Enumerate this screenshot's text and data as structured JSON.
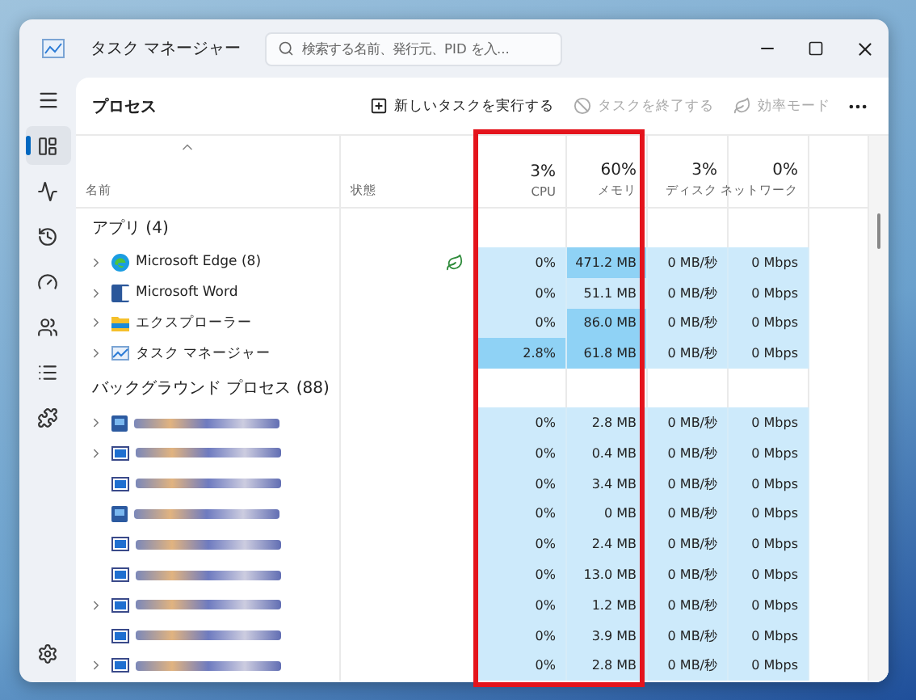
{
  "window": {
    "title": "タスク マネージャー"
  },
  "search": {
    "placeholder": "検索する名前、発行元、PID を入..."
  },
  "page_title": "プロセス",
  "toolbar": [
    {
      "kind": "run",
      "label": "新しいタスクを実行する",
      "disabled": false
    },
    {
      "kind": "end",
      "label": "タスクを終了する",
      "disabled": true
    },
    {
      "kind": "eco",
      "label": "効率モード",
      "disabled": true
    }
  ],
  "nav": [
    {
      "kind": "processes",
      "selected": true
    },
    {
      "kind": "performance",
      "selected": false
    },
    {
      "kind": "history",
      "selected": false
    },
    {
      "kind": "startup",
      "selected": false
    },
    {
      "kind": "users",
      "selected": false
    },
    {
      "kind": "details",
      "selected": false
    },
    {
      "kind": "services",
      "selected": false
    }
  ],
  "columns": [
    {
      "kind": "name",
      "label": "名前"
    },
    {
      "kind": "status",
      "label": "状態"
    },
    {
      "kind": "cpu",
      "total": "3%",
      "label": "CPU"
    },
    {
      "kind": "memory",
      "total": "60%",
      "label": "メモリ"
    },
    {
      "kind": "disk",
      "total": "3%",
      "label": "ディスク"
    },
    {
      "kind": "network",
      "total": "0%",
      "label": "ネットワーク"
    }
  ],
  "groups": [
    {
      "title": "アプリ (4)",
      "rows": [
        {
          "kind": "edge",
          "name": "Microsoft Edge (8)",
          "expandable": true,
          "efficiency": true,
          "cpu": "0%",
          "cpu_high": false,
          "memory": "471.2 MB",
          "memory_high": true,
          "disk": "0 MB/秒",
          "network": "0 Mbps"
        },
        {
          "kind": "word",
          "name": "Microsoft Word",
          "expandable": true,
          "cpu": "0%",
          "cpu_high": false,
          "memory": "51.1 MB",
          "memory_high": false,
          "disk": "0 MB/秒",
          "network": "0 Mbps"
        },
        {
          "kind": "folder",
          "name": "エクスプローラー",
          "expandable": true,
          "cpu": "0%",
          "cpu_high": false,
          "memory": "86.0 MB",
          "memory_high": true,
          "disk": "0 MB/秒",
          "network": "0 Mbps"
        },
        {
          "kind": "taskmgr",
          "name": "タスク マネージャー",
          "expandable": true,
          "cpu": "2.8%",
          "cpu_high": true,
          "memory": "61.8 MB",
          "memory_high": true,
          "disk": "0 MB/秒",
          "network": "0 Mbps"
        }
      ]
    },
    {
      "title": "バックグラウンド プロセス (88)",
      "rows": [
        {
          "kind": "app",
          "expandable": true,
          "cpu": "0%",
          "cpu_high": false,
          "memory": "2.8 MB",
          "memory_high": false,
          "disk": "0 MB/秒",
          "network": "0 Mbps"
        },
        {
          "kind": "window",
          "expandable": true,
          "cpu": "0%",
          "cpu_high": false,
          "memory": "0.4 MB",
          "memory_high": false,
          "disk": "0 MB/秒",
          "network": "0 Mbps"
        },
        {
          "kind": "window",
          "expandable": false,
          "cpu": "0%",
          "cpu_high": false,
          "memory": "3.4 MB",
          "memory_high": false,
          "disk": "0 MB/秒",
          "network": "0 Mbps"
        },
        {
          "kind": "app",
          "expandable": false,
          "cpu": "0%",
          "cpu_high": false,
          "memory": "0 MB",
          "memory_high": false,
          "disk": "0 MB/秒",
          "network": "0 Mbps"
        },
        {
          "kind": "window",
          "expandable": false,
          "cpu": "0%",
          "cpu_high": false,
          "memory": "2.4 MB",
          "memory_high": false,
          "disk": "0 MB/秒",
          "network": "0 Mbps"
        },
        {
          "kind": "window",
          "expandable": false,
          "cpu": "0%",
          "cpu_high": false,
          "memory": "13.0 MB",
          "memory_high": false,
          "disk": "0 MB/秒",
          "network": "0 Mbps"
        },
        {
          "kind": "window",
          "expandable": true,
          "cpu": "0%",
          "cpu_high": false,
          "memory": "1.2 MB",
          "memory_high": false,
          "disk": "0 MB/秒",
          "network": "0 Mbps"
        },
        {
          "kind": "window",
          "expandable": false,
          "cpu": "0%",
          "cpu_high": false,
          "memory": "3.9 MB",
          "memory_high": false,
          "disk": "0 MB/秒",
          "network": "0 Mbps"
        },
        {
          "kind": "window",
          "expandable": true,
          "cpu": "0%",
          "cpu_high": false,
          "memory": "2.8 MB",
          "memory_high": false,
          "disk": "0 MB/秒",
          "network": "0 Mbps"
        }
      ]
    }
  ]
}
